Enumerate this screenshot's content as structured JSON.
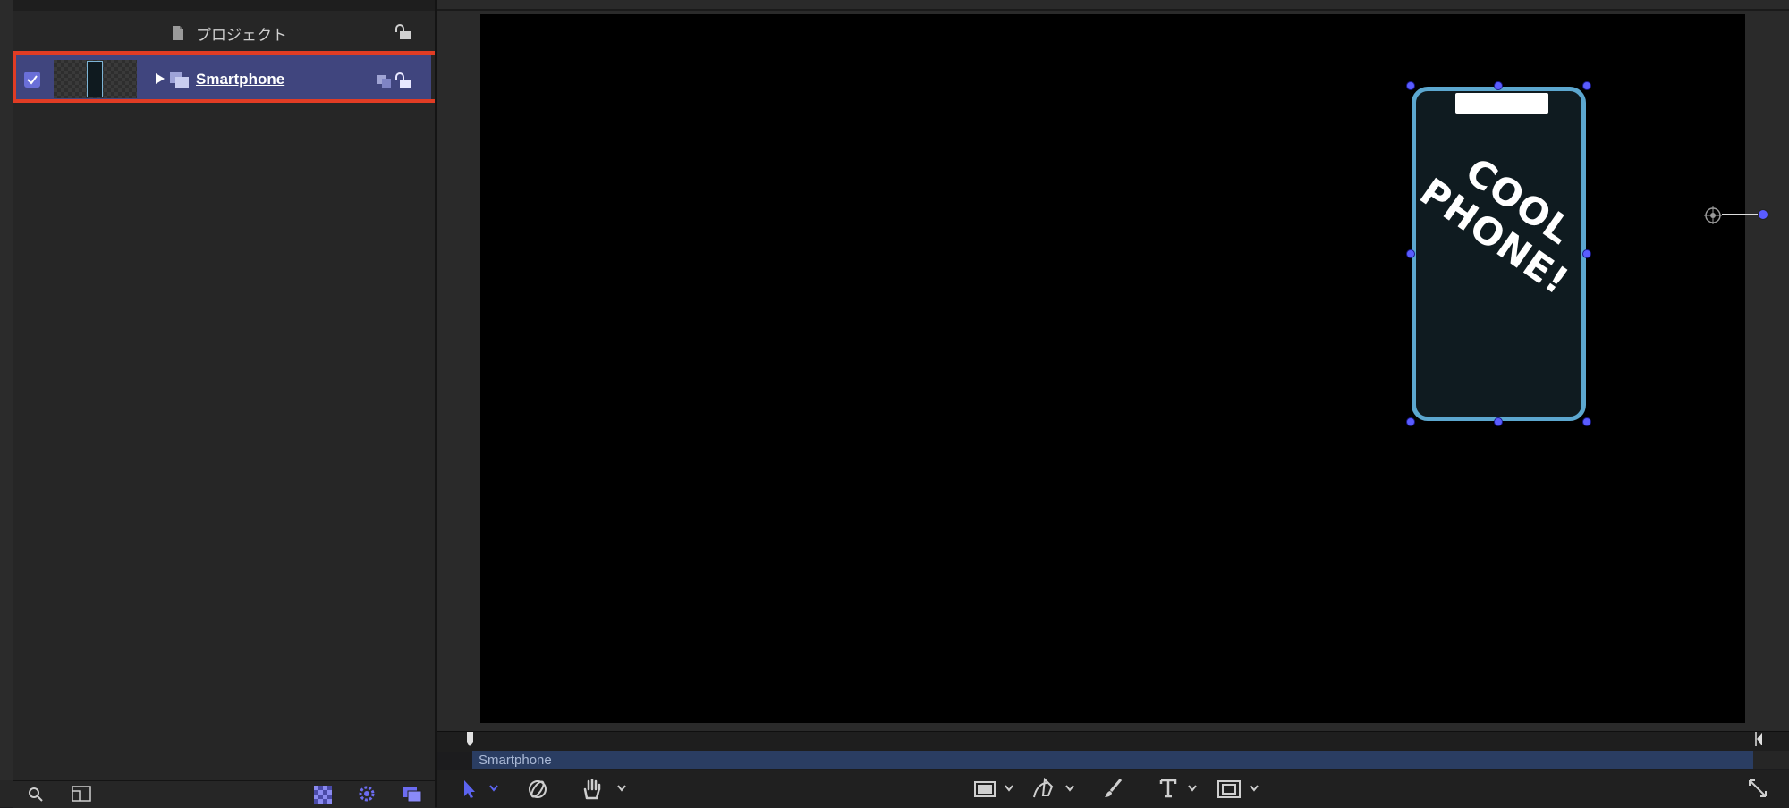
{
  "layers_panel": {
    "project_label": "プロジェクト",
    "layer": {
      "name": "Smartphone",
      "enabled": true,
      "selected": true
    }
  },
  "canvas": {
    "phone_text": "COOL\nPHONE!"
  },
  "timeline": {
    "bar_label": "Smartphone"
  },
  "colors": {
    "selection": "#40457e",
    "highlight": "#e03c24",
    "phone_border": "#5ca7cf",
    "handle": "#5a5cff",
    "timeline_bar": "#2a3d62"
  },
  "icons": {
    "left_bottom": [
      "search-icon",
      "layout-icon",
      "checkerboard-icon",
      "gear-icon",
      "layers-icon"
    ],
    "toolbar": [
      "select-arrow-icon",
      "orbit-icon",
      "pan-hand-icon",
      "rectangle-shape-icon",
      "pen-icon",
      "paintbrush-icon",
      "text-tool-icon",
      "mask-icon",
      "fullscreen-icon"
    ]
  }
}
